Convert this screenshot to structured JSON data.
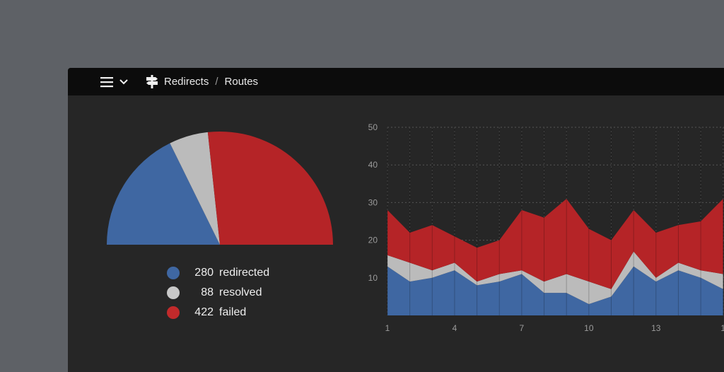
{
  "breadcrumb": {
    "items": [
      "Redirects",
      "Routes"
    ],
    "separator": "/"
  },
  "icons": {
    "menu": "hamburger-menu-icon",
    "dropdown": "chevron-down-icon",
    "breadcrumb": "signpost-icon"
  },
  "colors": {
    "redirected": "#3f67a2",
    "resolved": "#bbbbbb",
    "failed": "#b52427"
  },
  "legend": [
    {
      "value": "280",
      "label": "redirected",
      "color": "#3f67a2"
    },
    {
      "value": "88",
      "label": "resolved",
      "color": "#c8c8c8"
    },
    {
      "value": "422",
      "label": "failed",
      "color": "#c22a2b"
    }
  ],
  "chart_data": [
    {
      "type": "pie",
      "style": "half-donut",
      "categories": [
        "redirected",
        "resolved",
        "failed"
      ],
      "values": [
        280,
        88,
        422
      ]
    },
    {
      "type": "area",
      "stacked": true,
      "x": [
        1,
        2,
        3,
        4,
        5,
        6,
        7,
        8,
        9,
        10,
        11,
        12,
        13,
        14,
        15,
        16
      ],
      "x_ticks_shown": [
        "1",
        "4",
        "7",
        "10",
        "13",
        "1"
      ],
      "ylim": [
        0,
        50
      ],
      "y_ticks": [
        10,
        20,
        30,
        40,
        50
      ],
      "grid": true,
      "series": [
        {
          "values": [
            13,
            9,
            10,
            12,
            8,
            9,
            11,
            6,
            6,
            3,
            5,
            13,
            9,
            12,
            10,
            7
          ]
        },
        {
          "values": [
            3,
            5,
            2,
            2,
            1,
            2,
            1,
            3,
            5,
            6,
            2,
            4,
            1,
            2,
            2,
            4
          ]
        },
        {
          "values": [
            12,
            8,
            12,
            7,
            9,
            9,
            16,
            17,
            20,
            14,
            13,
            11,
            12,
            10,
            13,
            20
          ]
        }
      ]
    }
  ]
}
